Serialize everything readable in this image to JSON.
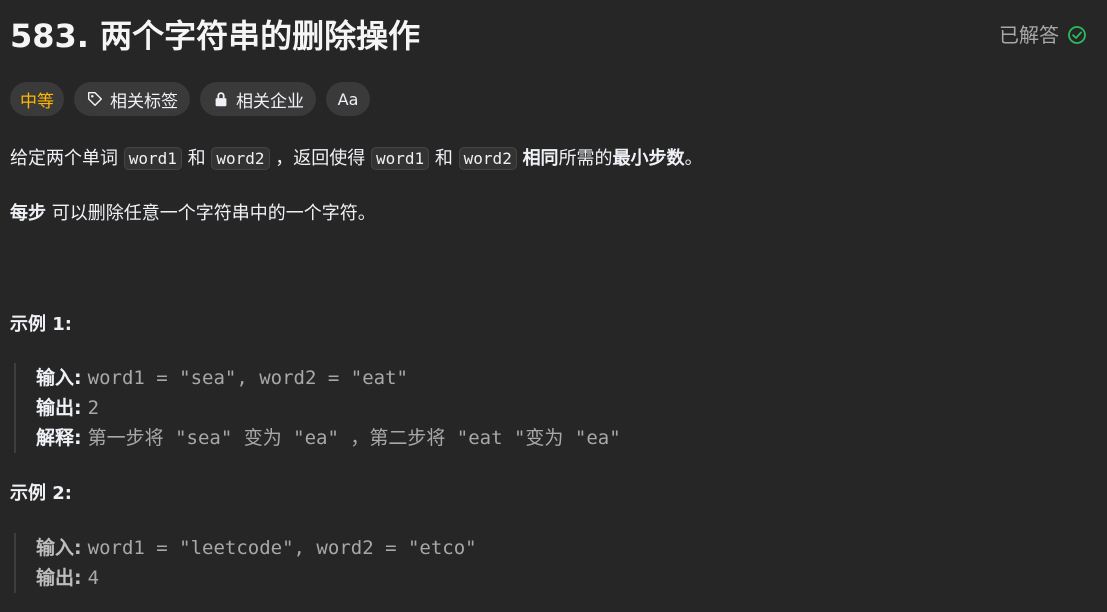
{
  "title": "583. 两个字符串的删除操作",
  "status": {
    "label": "已解答"
  },
  "tags": {
    "difficulty": "中等",
    "related_tags": "相关标签",
    "related_companies": "相关企业",
    "translate_label": "Aa"
  },
  "description": {
    "p1": [
      "给定两个单词",
      "word1",
      "和",
      "word2",
      "，返回使得",
      "word1",
      "和",
      "word2",
      "相同",
      "所需的",
      "最小步数",
      "。"
    ],
    "p2": [
      "每步",
      "可以删除任意一个字符串中的一个字符。"
    ]
  },
  "examples": [
    {
      "title": "示例 1:",
      "lines": [
        {
          "label": "输入:",
          "value": "word1 = \"sea\", word2 = \"eat\""
        },
        {
          "label": "输出:",
          "value": "2"
        },
        {
          "label": "解释:",
          "value": "第一步将 \"sea\" 变为 \"ea\" ，第二步将 \"eat \"变为 \"ea\""
        }
      ]
    },
    {
      "title": "示例  2:",
      "lines": [
        {
          "label": "输入:",
          "value": "word1 = \"leetcode\", word2 = \"etco\""
        },
        {
          "label": "输出:",
          "value": "4"
        }
      ]
    }
  ],
  "colors": {
    "background": "#262626",
    "difficulty": "#ffb800",
    "solved_check": "#2cbb5d",
    "tag_bg": "#3a3a3a"
  }
}
